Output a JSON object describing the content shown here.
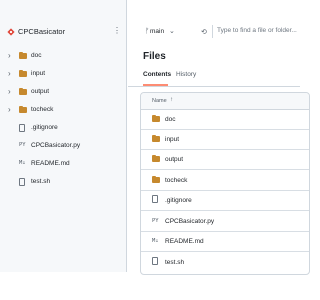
{
  "sidebar": {
    "repo_name": "CPCBasicator",
    "items": [
      {
        "label": "doc",
        "type": "folder"
      },
      {
        "label": "input",
        "type": "folder"
      },
      {
        "label": "output",
        "type": "folder"
      },
      {
        "label": "tocheck",
        "type": "folder"
      },
      {
        "label": ".gitignore",
        "type": "file"
      },
      {
        "label": "CPCBasicator.py",
        "type": "python"
      },
      {
        "label": "README.md",
        "type": "markdown"
      },
      {
        "label": "test.sh",
        "type": "file"
      }
    ]
  },
  "topbar": {
    "branch": "main",
    "search_placeholder": "Type to find a file or folder..."
  },
  "main": {
    "title": "Files",
    "tabs": [
      "Contents",
      "History"
    ],
    "table": {
      "header": "Name",
      "rows": [
        {
          "label": "doc",
          "type": "folder"
        },
        {
          "label": "input",
          "type": "folder"
        },
        {
          "label": "output",
          "type": "folder"
        },
        {
          "label": "tocheck",
          "type": "folder"
        },
        {
          "label": ".gitignore",
          "type": "file"
        },
        {
          "label": "CPCBasicator.py",
          "type": "python"
        },
        {
          "label": "README.md",
          "type": "markdown"
        },
        {
          "label": "test.sh",
          "type": "file"
        }
      ]
    }
  },
  "colors": {
    "folder": "#c6892e",
    "accent_underline": "#fd8c73",
    "repo_icon": "#e0483a"
  },
  "icons": {
    "folder": "folder-icon",
    "file": "file-icon",
    "python": "python-file-icon",
    "markdown": "markdown-icon"
  }
}
